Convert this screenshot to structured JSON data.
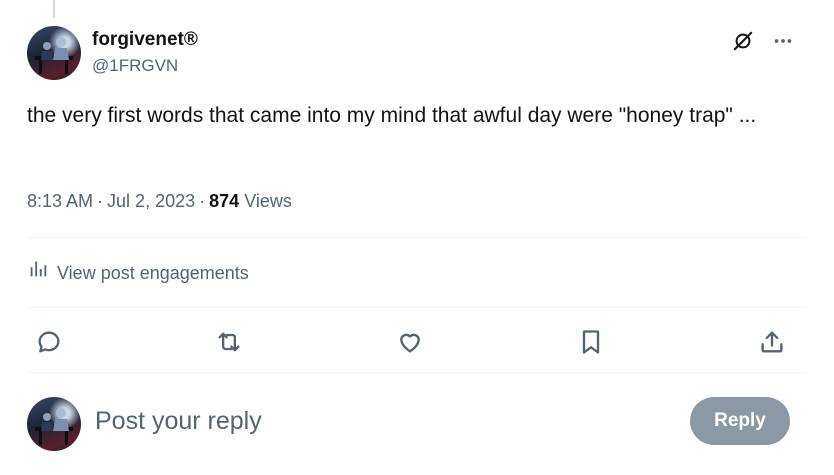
{
  "post": {
    "author": {
      "display_name": "forgivenet®",
      "handle": "@1FRGVN",
      "avatar_icon": "avatar-image"
    },
    "text": "the very first words that came into my mind that awful day were \"honey trap\" ...",
    "time": "8:13 AM",
    "date": "Jul 2, 2023",
    "views_count": "874",
    "views_label": "Views"
  },
  "header_icons": [
    "grok-slash-icon",
    "more-dots-icon"
  ],
  "engagements": {
    "label": "View post engagements",
    "icon": "bar-chart-icon"
  },
  "actions": [
    {
      "name": "reply",
      "icon": "reply-icon"
    },
    {
      "name": "repost",
      "icon": "repost-icon"
    },
    {
      "name": "like",
      "icon": "heart-icon"
    },
    {
      "name": "bookmark",
      "icon": "bookmark-icon"
    },
    {
      "name": "share",
      "icon": "share-icon"
    }
  ],
  "reply_box": {
    "placeholder": "Post your reply",
    "button_label": "Reply"
  },
  "colors": {
    "text_primary": "#0f1419",
    "text_secondary": "#536471",
    "divider": "#eff3f4",
    "reply_button_disabled": "#8b98a5"
  }
}
